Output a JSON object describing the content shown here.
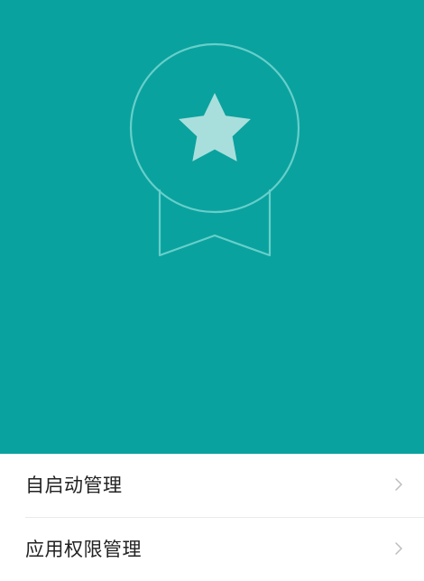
{
  "hero": {
    "background_color": "#0aa29e",
    "badge": {
      "icon": "medal-star-icon",
      "outline_color": "#66cfcb",
      "star_color": "#a8dfdc"
    }
  },
  "settings_list": {
    "items": [
      {
        "label": "自启动管理",
        "icon": "chevron-right-icon"
      },
      {
        "label": "应用权限管理",
        "icon": "chevron-right-icon"
      }
    ]
  }
}
